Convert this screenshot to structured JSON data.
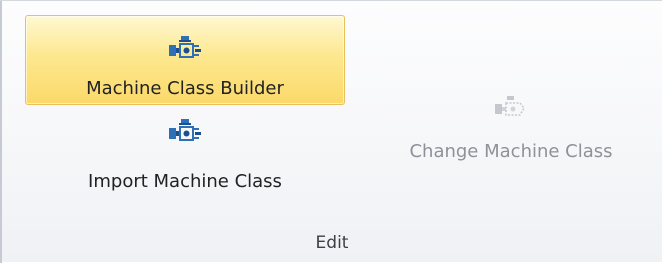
{
  "ribbon": {
    "group_label": "Edit",
    "buttons": {
      "machine_class_builder": {
        "label": "Machine Class Builder",
        "icon": "machine-class-icon",
        "state": "hovered"
      },
      "import_machine_class": {
        "label": "Import Machine Class",
        "icon": "machine-class-icon",
        "state": "normal"
      },
      "change_machine_class": {
        "label": "Change Machine Class",
        "icon": "machine-class-icon",
        "state": "disabled"
      }
    }
  },
  "colors": {
    "hover_fill": "#fde88f",
    "hover_border": "#e8c15b",
    "icon_blue": "#2f6fb8",
    "disabled_text": "#8d9299"
  }
}
